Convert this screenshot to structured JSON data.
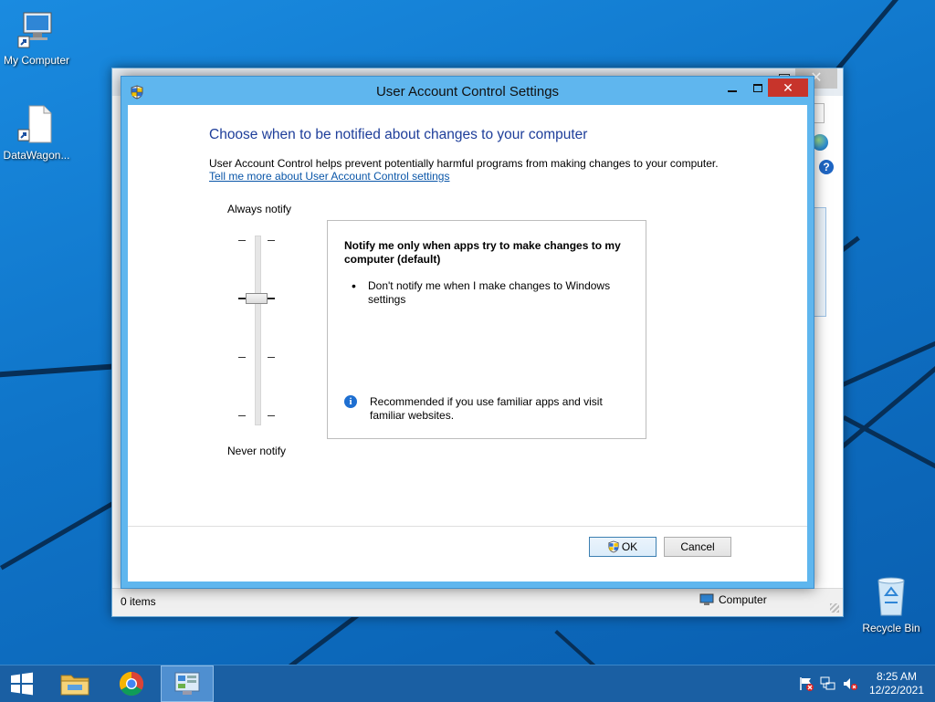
{
  "desktop": {
    "icons": [
      {
        "label": "My Computer"
      },
      {
        "label": "DataWagon..."
      },
      {
        "label": "Recycle Bin"
      }
    ]
  },
  "explorer": {
    "close_glyph": "✕",
    "status_items": "0 items",
    "status_location": "Computer",
    "help_glyph": "?"
  },
  "uac": {
    "title": "User Account Control Settings",
    "close_glyph": "✕",
    "heading": "Choose when to be notified about changes to your computer",
    "description": "User Account Control helps prevent potentially harmful programs from making changes to your computer.",
    "link": "Tell me more about User Account Control settings",
    "slider": {
      "top_label": "Always notify",
      "bottom_label": "Never notify",
      "levels": 4,
      "selected_level": 3
    },
    "info": {
      "title": "Notify me only when apps try to make changes to my computer (default)",
      "bullet_glyph": "•",
      "bullet": "Don't notify me when I make changes to Windows settings",
      "info_glyph": "i",
      "recommendation": "Recommended if you use familiar apps and visit familiar websites."
    },
    "buttons": {
      "ok": "OK",
      "cancel": "Cancel"
    }
  },
  "taskbar": {
    "apps": [
      {
        "icon": "windows-logo-icon"
      },
      {
        "icon": "file-explorer-icon"
      },
      {
        "icon": "chrome-icon"
      },
      {
        "icon": "control-panel-icon"
      }
    ],
    "clock": {
      "time": "8:25 AM",
      "date": "12/22/2021"
    }
  },
  "colors": {
    "accent": "#5fb6ee",
    "heading": "#1e3e9a",
    "link": "#0a56a8",
    "close_red": "#c7342b",
    "taskbar": "#1a5fa3"
  }
}
